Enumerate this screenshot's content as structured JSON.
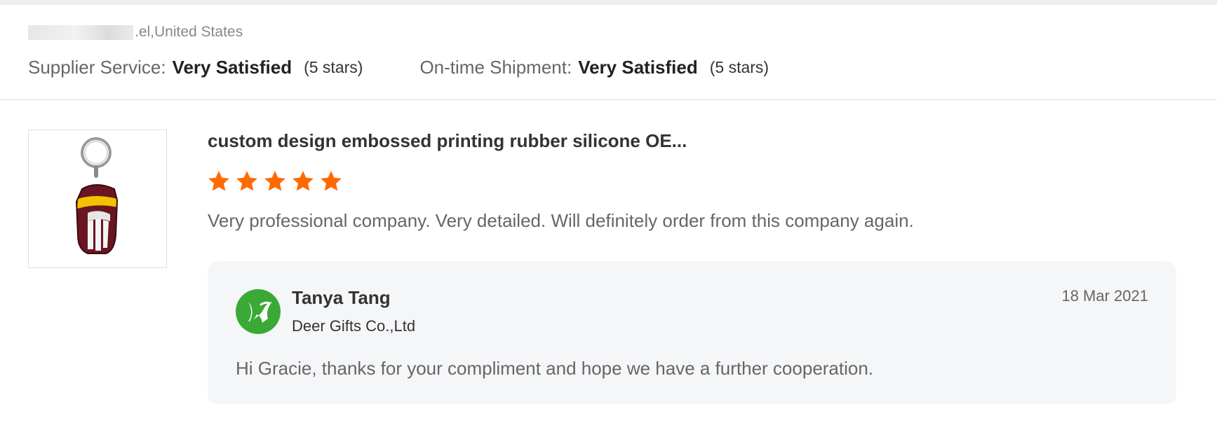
{
  "reviewer": {
    "location": ".el,United States"
  },
  "ratings": [
    {
      "label": "Supplier Service:",
      "value": "Very Satisfied",
      "count": "(5 stars)"
    },
    {
      "label": "On-time Shipment:",
      "value": "Very Satisfied",
      "count": "(5 stars)"
    }
  ],
  "review": {
    "product_title": "custom design embossed printing rubber silicone OE...",
    "stars": 5,
    "text": "Very professional company. Very detailed. Will definitely order from this company again."
  },
  "reply": {
    "supplier_name": "Tanya Tang",
    "company": "Deer Gifts Co.,Ltd",
    "date": "18 Mar 2021",
    "text": "Hi Gracie, thanks for your compliment and hope we have a further cooperation."
  },
  "colors": {
    "star": "#ff6a00",
    "logo": "#3aa935",
    "reply_background": "#f5f6f8"
  },
  "icons": {
    "star": "star-icon",
    "logo": "supplier-logo-icon"
  }
}
